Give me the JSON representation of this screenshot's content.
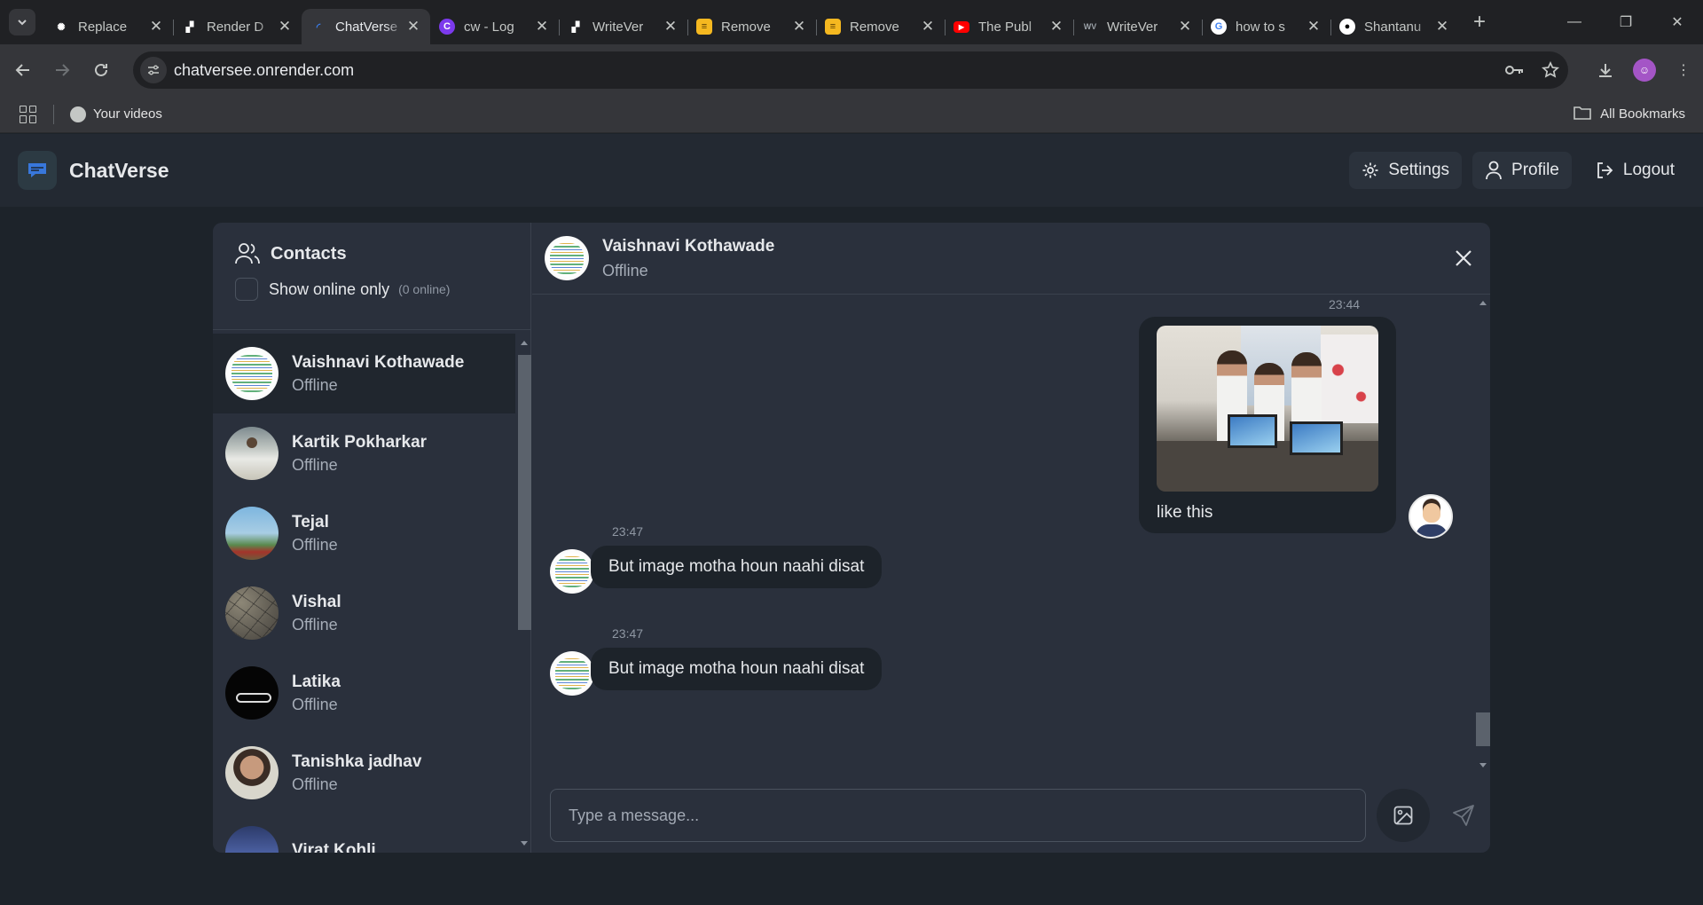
{
  "browser": {
    "tabs": [
      {
        "title": "Replace",
        "favicon": "openai-icon",
        "color": "#ffffff",
        "active": false
      },
      {
        "title": "Render D",
        "favicon": "render-icon",
        "color": "#ffffff",
        "active": false
      },
      {
        "title": "ChatVerse",
        "favicon": "chatverse-icon",
        "color": "#3b82f6",
        "active": true
      },
      {
        "title": "cw - Log",
        "favicon": "canva-icon",
        "color": "#7c3aed",
        "active": false
      },
      {
        "title": "WriteVer",
        "favicon": "render-icon",
        "color": "#ffffff",
        "active": false
      },
      {
        "title": "Remove",
        "favicon": "layers-icon",
        "color": "#f5b820",
        "active": false
      },
      {
        "title": "Remove",
        "favicon": "layers-icon",
        "color": "#f5b820",
        "active": false
      },
      {
        "title": "The Publ",
        "favicon": "youtube-icon",
        "color": "#ff0000",
        "active": false
      },
      {
        "title": "WriteVer",
        "favicon": "writeverse-icon",
        "color": "#9aa0a6",
        "active": false
      },
      {
        "title": "how to s",
        "favicon": "google-icon",
        "color": "#ffffff",
        "active": false
      },
      {
        "title": "Shantanu",
        "favicon": "github-icon",
        "color": "#ffffff",
        "active": false
      }
    ],
    "url": "chatversee.onrender.com",
    "bookmarks": {
      "item": "Your videos",
      "all": "All Bookmarks"
    }
  },
  "app": {
    "brand": "ChatVerse",
    "nav": {
      "settings": "Settings",
      "profile": "Profile",
      "logout": "Logout"
    }
  },
  "sidebar": {
    "title": "Contacts",
    "filter_label": "Show online only",
    "online_count": "(0 online)",
    "contacts": [
      {
        "name": "Vaishnavi Kothawade",
        "status": "Offline",
        "selected": true
      },
      {
        "name": "Kartik Pokharkar",
        "status": "Offline"
      },
      {
        "name": "Tejal",
        "status": "Offline"
      },
      {
        "name": "Vishal",
        "status": "Offline"
      },
      {
        "name": "Latika",
        "status": "Offline"
      },
      {
        "name": "Tanishka jadhav",
        "status": "Offline"
      },
      {
        "name": "Virat Kohli",
        "status": ""
      }
    ]
  },
  "conversation": {
    "name": "Vaishnavi Kothawade",
    "status": "Offline",
    "messages": [
      {
        "time": "23:44",
        "text": "like this",
        "from": "me",
        "has_image": true
      },
      {
        "time": "23:47",
        "text": "But image motha houn naahi disat",
        "from": "them"
      },
      {
        "time": "23:47",
        "text": "But image motha houn naahi disat",
        "from": "them"
      }
    ],
    "input_placeholder": "Type a message..."
  }
}
